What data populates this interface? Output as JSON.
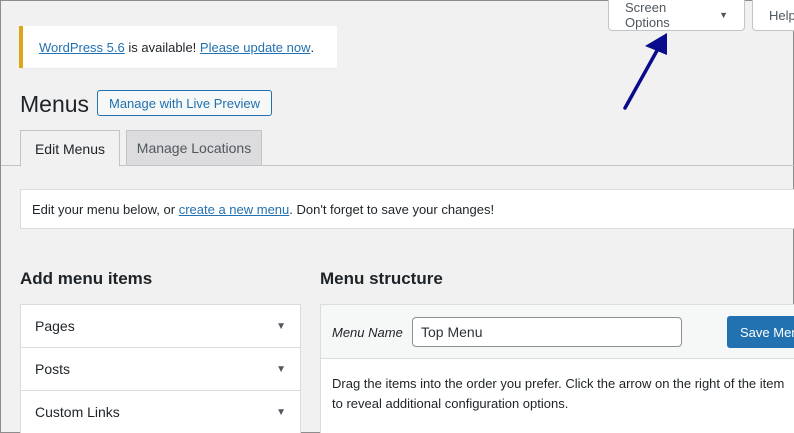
{
  "screen_meta": {
    "screen_options_label": "Screen Options",
    "help_label": "Help"
  },
  "notice": {
    "version_link": "WordPress 5.6",
    "middle_text": " is available! ",
    "update_link": "Please update now",
    "end_text": "."
  },
  "header": {
    "title": "Menus",
    "live_preview_label": "Manage with Live Preview"
  },
  "tabs": [
    {
      "label": "Edit Menus",
      "active": true
    },
    {
      "label": "Manage Locations",
      "active": false
    }
  ],
  "manage_info": {
    "prefix": "Edit your menu below, or ",
    "link": "create a new menu",
    "suffix": ". Don't forget to save your changes!"
  },
  "add_items": {
    "heading": "Add menu items",
    "items": [
      {
        "label": "Pages"
      },
      {
        "label": "Posts"
      },
      {
        "label": "Custom Links"
      }
    ]
  },
  "menu_structure": {
    "heading": "Menu structure",
    "name_label": "Menu Name",
    "name_value": "Top Menu",
    "save_label": "Save Menu",
    "instructions": "Drag the items into the order you prefer. Click the arrow on the right of the item to reveal additional configuration options."
  },
  "colors": {
    "accent": "#2271b1",
    "notice_border": "#dba617",
    "annotation_arrow": "#0a0a8c"
  },
  "icons": {
    "dropdown": "caret-down-icon",
    "annotation": "arrow-annotation-icon"
  }
}
